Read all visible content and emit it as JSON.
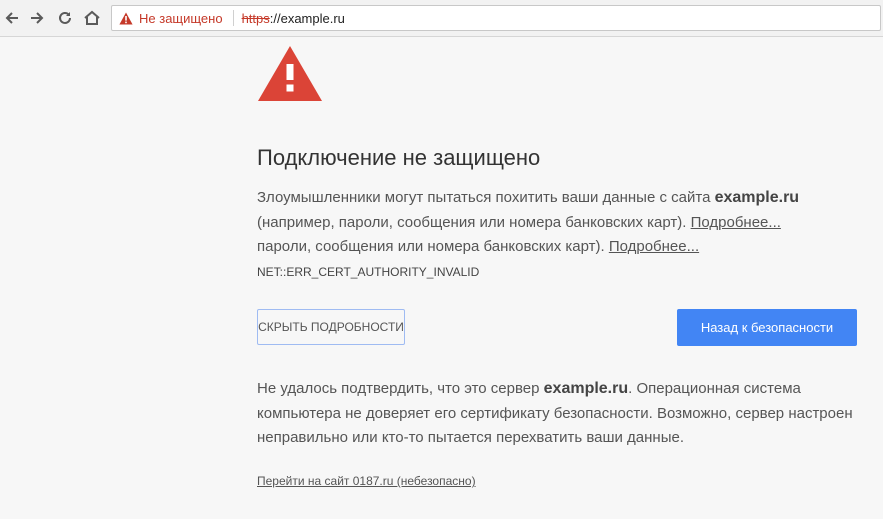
{
  "browser": {
    "status_text": "Не защищено",
    "url_scheme": "https",
    "url_rest": "://example.ru",
    "icons": {
      "back": "back-arrow-icon",
      "forward": "forward-arrow-icon",
      "reload": "reload-icon",
      "home": "home-icon",
      "warning": "warning-icon"
    },
    "colors": {
      "danger": "#c53929",
      "accent": "#4285f4"
    }
  },
  "interstitial": {
    "title": "Подключение не защищено",
    "para1": {
      "line1_text": "Злоумышленники могут пытаться похитить ваши данные с сайта ",
      "line1_site": "example.ru",
      "line2_text": "(например, пароли, сообщения или номера банковских карт). ",
      "line2_link": "Подробнее...",
      "line3_text": "пароли, сообщения или номера банковских карт). ",
      "line3_link": "Подробнее..."
    },
    "error_code": "NET::ERR_CERT_AUTHORITY_INVALID",
    "details_button": "СКРЫТЬ ПОДРОБНОСТИ",
    "back_button": "Назад к безопасности",
    "para2": {
      "line1_a": "Не удалось подтвердить, что это сервер ",
      "line1_site": "example.ru",
      "line1_b": ". Операционная система",
      "line2": "компьютера не доверяет его сертификату безопасности. Возможно, сервер настроен",
      "line3": "неправильно или кто-то пытается перехватить ваши данные."
    },
    "proceed_link": "Перейти на сайт 0187.ru (небезопасно)"
  }
}
